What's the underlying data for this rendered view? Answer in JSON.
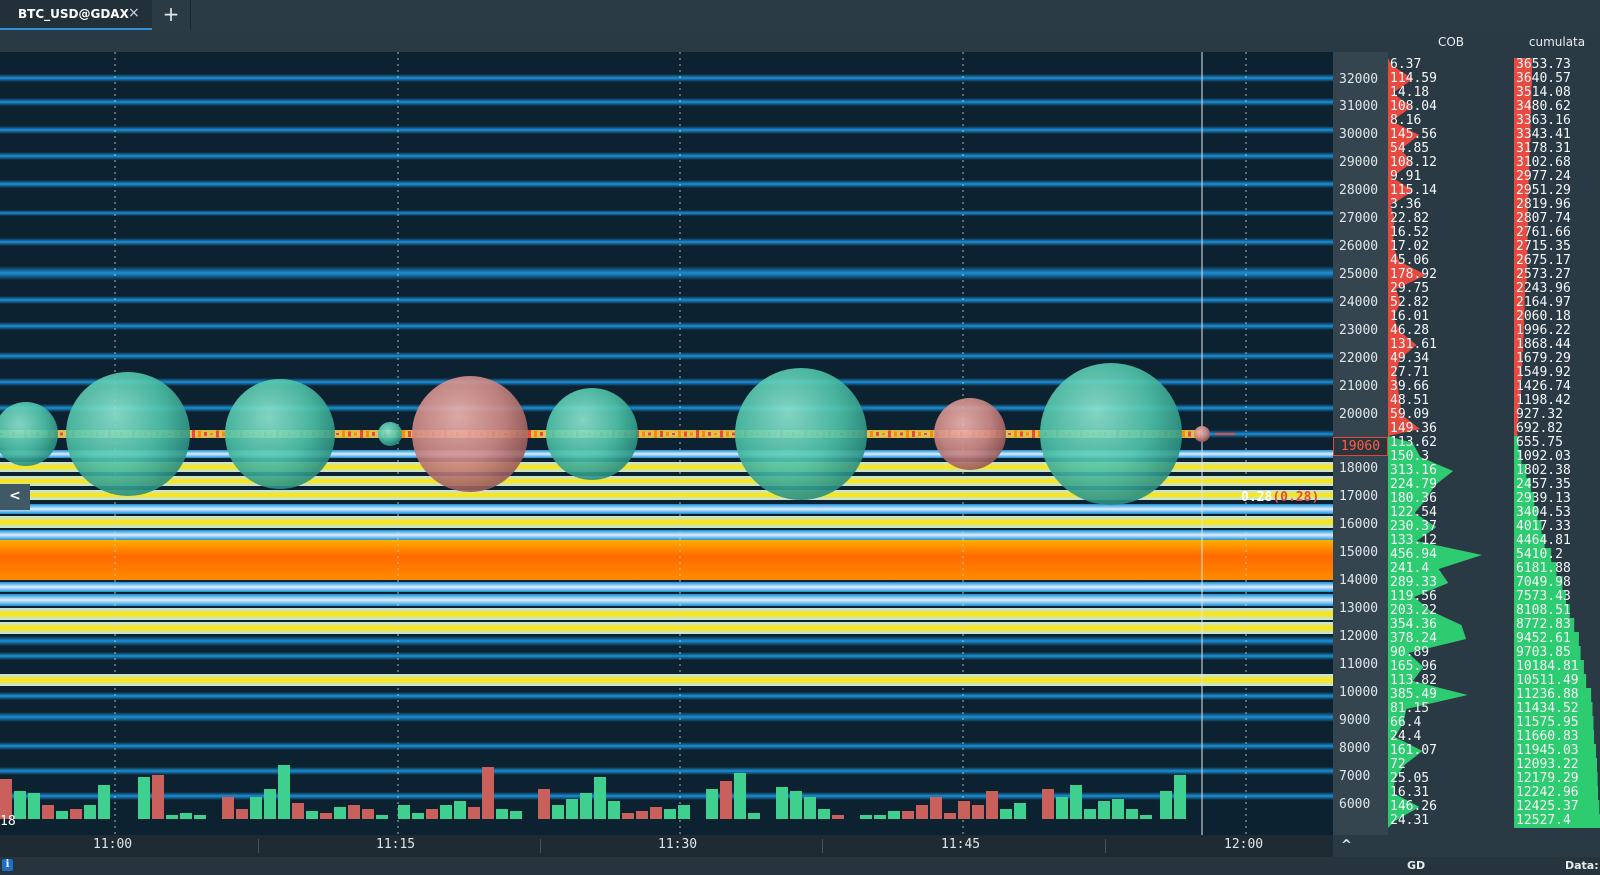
{
  "tab": {
    "title": "BTC_USD@GDAX",
    "close": "×",
    "add": "+"
  },
  "columns": {
    "cob": "COB",
    "cumulative": "cumulata"
  },
  "price_axis": {
    "ticks": [
      "32000",
      "31000",
      "30000",
      "29000",
      "28000",
      "27000",
      "26000",
      "25000",
      "24000",
      "23000",
      "22000",
      "21000",
      "20000",
      "18000",
      "17000",
      "16000",
      "15000",
      "14000",
      "13000",
      "12000",
      "11000",
      "10000",
      "9000",
      "8000",
      "7000",
      "6000"
    ],
    "current": "19060"
  },
  "last_trade": {
    "size": "0.28",
    "detail": "(0.28)"
  },
  "volume_label": "18",
  "time_axis": [
    "11:00",
    "11:15",
    "11:30",
    "11:45",
    "12:00"
  ],
  "collapse_button": "<",
  "scroll_up": "^",
  "status": {
    "gd": "GD",
    "data": "Data:"
  },
  "colors": {
    "ask": "#e84a3f",
    "bid": "#2ecc71",
    "heat_hot": "#ff6a00",
    "heat_warm": "#ffe600",
    "heat_cool": "#1a8fd6",
    "bubble_buy": "#5fd4b8",
    "bubble_sell": "#d88a86"
  },
  "book": {
    "asks": [
      {
        "cob": "6.37",
        "cum": "3653.73"
      },
      {
        "cob": "114.59",
        "cum": "3640.57"
      },
      {
        "cob": "14.18",
        "cum": "3514.08"
      },
      {
        "cob": "108.04",
        "cum": "3480.62"
      },
      {
        "cob": "8.16",
        "cum": "3363.16"
      },
      {
        "cob": "145.56",
        "cum": "3343.41"
      },
      {
        "cob": "54.85",
        "cum": "3178.31"
      },
      {
        "cob": "108.12",
        "cum": "3102.68"
      },
      {
        "cob": "9.91",
        "cum": "2977.24"
      },
      {
        "cob": "115.14",
        "cum": "2951.29"
      },
      {
        "cob": "3.36",
        "cum": "2819.96"
      },
      {
        "cob": "22.82",
        "cum": "2807.74"
      },
      {
        "cob": "16.52",
        "cum": "2761.66"
      },
      {
        "cob": "17.02",
        "cum": "2715.35"
      },
      {
        "cob": "45.06",
        "cum": "2675.17"
      },
      {
        "cob": "178.92",
        "cum": "2573.27"
      },
      {
        "cob": "29.75",
        "cum": "2243.96"
      },
      {
        "cob": "52.82",
        "cum": "2164.97"
      },
      {
        "cob": "16.01",
        "cum": "2060.18"
      },
      {
        "cob": "46.28",
        "cum": "1996.22"
      },
      {
        "cob": "131.61",
        "cum": "1868.44"
      },
      {
        "cob": "49.34",
        "cum": "1679.29"
      },
      {
        "cob": "27.71",
        "cum": "1549.92"
      },
      {
        "cob": "39.66",
        "cum": "1426.74"
      },
      {
        "cob": "48.51",
        "cum": "1198.42"
      },
      {
        "cob": "59.09",
        "cum": "927.32"
      },
      {
        "cob": "149.36",
        "cum": "692.82"
      }
    ],
    "bids": [
      {
        "cob": "113.62",
        "cum": "655.75"
      },
      {
        "cob": "150.3",
        "cum": "1092.03"
      },
      {
        "cob": "313.16",
        "cum": "1802.38"
      },
      {
        "cob": "224.79",
        "cum": "2457.35"
      },
      {
        "cob": "180.36",
        "cum": "2939.13"
      },
      {
        "cob": "122.54",
        "cum": "3404.53"
      },
      {
        "cob": "230.37",
        "cum": "4017.33"
      },
      {
        "cob": "133.12",
        "cum": "4464.81"
      },
      {
        "cob": "456.94",
        "cum": "5410.2"
      },
      {
        "cob": "241.4",
        "cum": "6181.88"
      },
      {
        "cob": "289.33",
        "cum": "7049.98"
      },
      {
        "cob": "119.56",
        "cum": "7573.43"
      },
      {
        "cob": "203.22",
        "cum": "8108.51"
      },
      {
        "cob": "354.36",
        "cum": "8772.83"
      },
      {
        "cob": "378.24",
        "cum": "9452.61"
      },
      {
        "cob": "90.89",
        "cum": "9703.85"
      },
      {
        "cob": "165.96",
        "cum": "10184.81"
      },
      {
        "cob": "113.82",
        "cum": "10511.49"
      },
      {
        "cob": "385.49",
        "cum": "11236.88"
      },
      {
        "cob": "81.15",
        "cum": "11434.52"
      },
      {
        "cob": "66.4",
        "cum": "11575.95"
      },
      {
        "cob": "24.4",
        "cum": "11660.83"
      },
      {
        "cob": "161.07",
        "cum": "11945.03"
      },
      {
        "cob": "72",
        "cum": "12093.22"
      },
      {
        "cob": "25.05",
        "cum": "12179.29"
      },
      {
        "cob": "16.31",
        "cum": "12242.96"
      },
      {
        "cob": "146.26",
        "cum": "12425.37"
      },
      {
        "cob": "24.31",
        "cum": "12527.4"
      }
    ]
  }
}
